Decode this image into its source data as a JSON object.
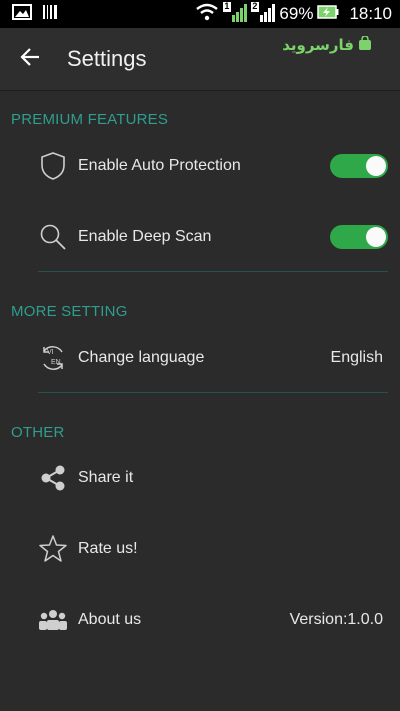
{
  "status_bar": {
    "battery": "69%",
    "time": "18:10",
    "sim1": "1",
    "sim2": "2"
  },
  "app_bar": {
    "title": "Settings",
    "watermark": "فارسروید"
  },
  "sections": {
    "premium": {
      "header": "PREMIUM FEATURES",
      "items": [
        {
          "label": "Enable Auto Protection",
          "icon": "shield-icon",
          "toggle_on": true
        },
        {
          "label": "Enable Deep Scan",
          "icon": "search-icon",
          "toggle_on": true
        }
      ]
    },
    "more": {
      "header": "MORE SETTING",
      "items": [
        {
          "label": "Change language",
          "value": "English",
          "icon": "language-icon",
          "icon_text_top": "VI",
          "icon_text_bottom": "EN"
        }
      ]
    },
    "other": {
      "header": "OTHER",
      "items": [
        {
          "label": "Share it",
          "icon": "share-icon"
        },
        {
          "label": "Rate us!",
          "icon": "star-icon"
        },
        {
          "label": "About us",
          "value": "Version:1.0.0",
          "icon": "group-icon"
        }
      ]
    }
  },
  "colors": {
    "accent": "#2f9e8f",
    "toggle_on": "#2fa84a",
    "background": "#2b2b2b"
  }
}
